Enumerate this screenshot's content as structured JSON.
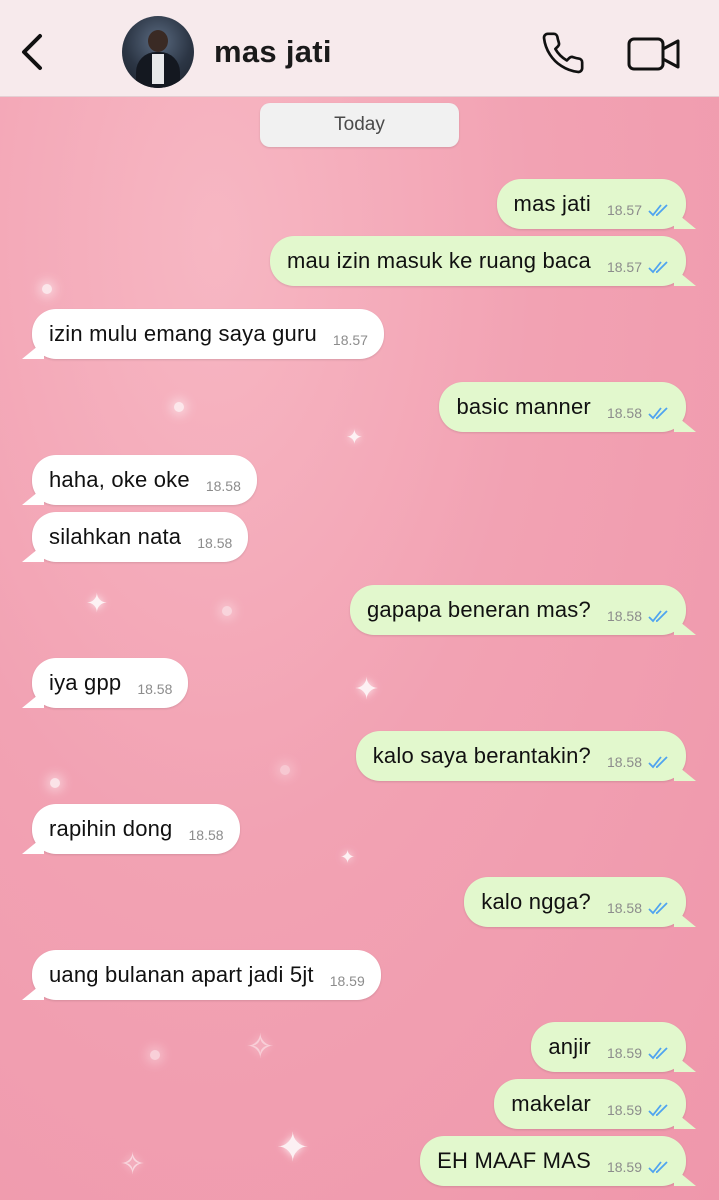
{
  "header": {
    "contact_name": "mas jati",
    "back_icon": "chevron-left-icon",
    "call_icon": "phone-icon",
    "video_icon": "video-camera-icon"
  },
  "date_separator": "Today",
  "colors": {
    "outgoing_bubble": "#e2f8cd",
    "incoming_bubble": "#ffffff",
    "read_ticks": "#4fa3f0",
    "background": "#f2a2b3"
  },
  "messages": [
    {
      "dir": "out",
      "text": "mas jati",
      "time": "18.57",
      "read": true
    },
    {
      "dir": "out",
      "text": "mau izin masuk ke ruang baca",
      "time": "18.57",
      "read": true
    },
    {
      "dir": "in",
      "text": "izin mulu emang saya guru",
      "time": "18.57"
    },
    {
      "dir": "out",
      "text": "basic manner",
      "time": "18.58",
      "read": true
    },
    {
      "dir": "in",
      "text": "haha, oke oke",
      "time": "18.58"
    },
    {
      "dir": "in",
      "text": "silahkan nata",
      "time": "18.58"
    },
    {
      "dir": "out",
      "text": "gapapa beneran mas?",
      "time": "18.58",
      "read": true
    },
    {
      "dir": "in",
      "text": "iya gpp",
      "time": "18.58"
    },
    {
      "dir": "out",
      "text": "kalo saya berantakin?",
      "time": "18.58",
      "read": true
    },
    {
      "dir": "in",
      "text": "rapihin dong",
      "time": "18.58"
    },
    {
      "dir": "out",
      "text": "kalo ngga?",
      "time": "18.58",
      "read": true
    },
    {
      "dir": "in",
      "text": "uang bulanan apart jadi 5jt",
      "time": "18.59"
    },
    {
      "dir": "out",
      "text": "anjir",
      "time": "18.59",
      "read": true
    },
    {
      "dir": "out",
      "text": "makelar",
      "time": "18.59",
      "read": true
    },
    {
      "dir": "out",
      "text": "EH MAAF MAS",
      "time": "18.59",
      "read": true
    }
  ]
}
